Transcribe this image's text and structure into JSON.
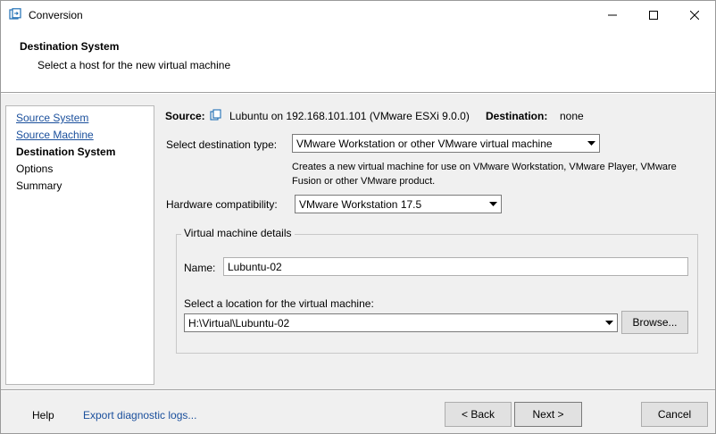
{
  "window": {
    "title": "Conversion",
    "icon": "converter-app-icon"
  },
  "header": {
    "title": "Destination System",
    "subtitle": "Select a host for the new virtual machine"
  },
  "nav": {
    "items": [
      {
        "label": "Source System",
        "state": "link"
      },
      {
        "label": "Source Machine",
        "state": "link"
      },
      {
        "label": "Destination System",
        "state": "current"
      },
      {
        "label": "Options",
        "state": "plain"
      },
      {
        "label": "Summary",
        "state": "plain"
      }
    ]
  },
  "source_line": {
    "source_label": "Source:",
    "source_value": "Lubuntu on 192.168.101.101 (VMware ESXi 9.0.0)",
    "destination_label": "Destination:",
    "destination_value": "none"
  },
  "destination_type": {
    "label": "Select destination type:",
    "selected": "VMware Workstation or other VMware virtual machine",
    "description_line1": "Creates a new virtual machine for use on VMware Workstation, VMware Player, VMware",
    "description_line2": "Fusion or other VMware product."
  },
  "hardware": {
    "label": "Hardware compatibility:",
    "selected": "VMware Workstation 17.5"
  },
  "vm_details": {
    "legend": "Virtual machine details",
    "name_label": "Name:",
    "name_value": "Lubuntu-02",
    "location_label": "Select a location for the virtual machine:",
    "location_value": "H:\\Virtual\\Lubuntu-02",
    "browse_label": "Browse..."
  },
  "footer": {
    "help": "Help",
    "export_logs": "Export diagnostic logs...",
    "back": "< Back",
    "next": "Next >",
    "cancel": "Cancel"
  },
  "colors": {
    "link": "#1a4f9c",
    "window_bg": "#f0f0f0",
    "header_bg": "#ffffff"
  }
}
